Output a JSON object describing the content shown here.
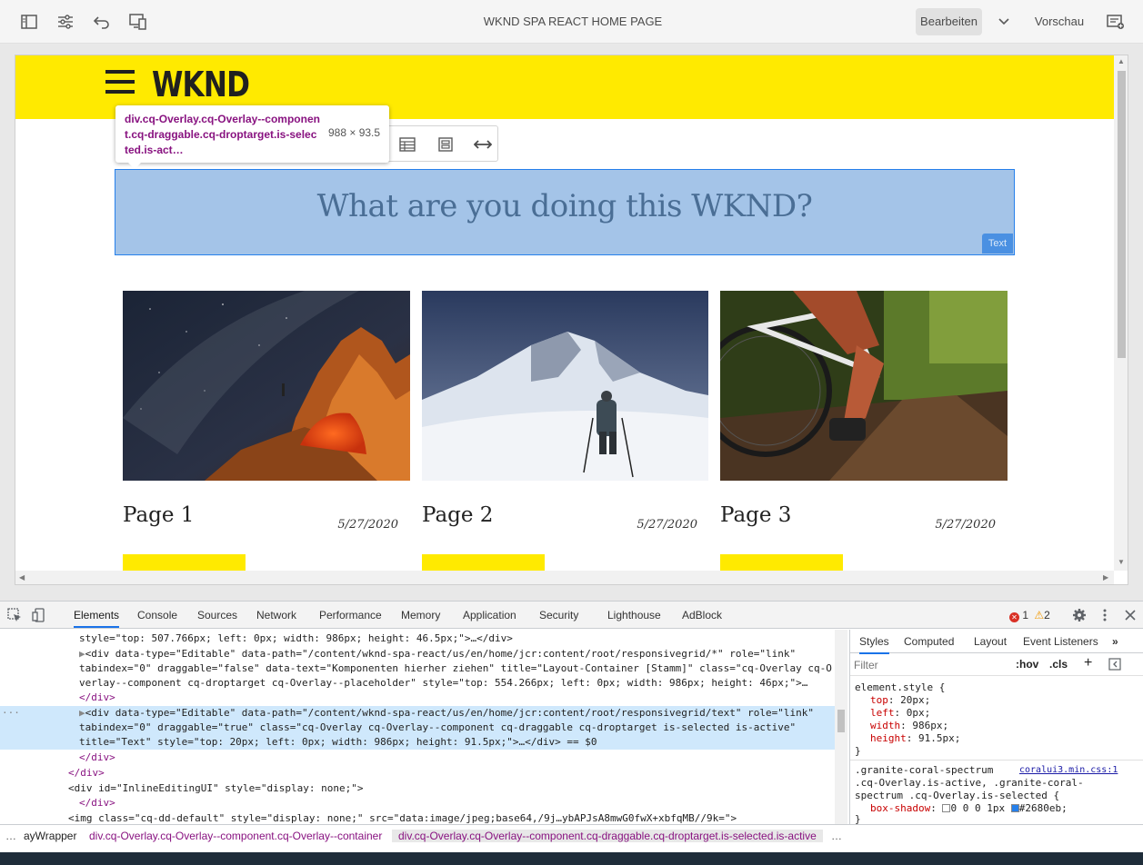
{
  "editor": {
    "page_title": "WKND SPA REACT HOME PAGE",
    "mode_label": "Bearbeiten",
    "preview_label": "Vorschau",
    "icons": [
      "side-panel-icon",
      "page-properties-icon",
      "undo-icon",
      "emulator-icon",
      "annotations-icon"
    ]
  },
  "site": {
    "logo": "WKND",
    "heading": "What are you doing this WKND?",
    "overlay_tag": "Text",
    "cards": [
      {
        "title": "Page 1",
        "date": "5/27/2020",
        "image": "night-camping-photo"
      },
      {
        "title": "Page 2",
        "date": "5/27/2020",
        "image": "snowy-mountain-hiker-photo"
      },
      {
        "title": "Page 3",
        "date": "5/27/2020",
        "image": "mountain-bike-trail-photo"
      }
    ]
  },
  "inspector_tooltip": {
    "selector": "div.cq-Overlay.cq-Overlay--component.cq-draggable.cq-droptarget.is-selected.is-act…",
    "dimensions": "988 × 93.5"
  },
  "devtools": {
    "tabs": [
      "Elements",
      "Console",
      "Sources",
      "Network",
      "Performance",
      "Memory",
      "Application",
      "Security",
      "Lighthouse",
      "AdBlock"
    ],
    "errors": "1",
    "warnings": "2",
    "dom_lines": [
      "style=\"top: 507.766px; left: 0px; width: 986px; height: 46.5px;\">…</div>",
      "<div data-type=\"Editable\" data-path=\"/content/wknd-spa-react/us/en/home/jcr:content/root/responsivegrid/*\" role=\"link\"",
      "tabindex=\"0\" draggable=\"false\" data-text=\"Komponenten hierher ziehen\" title=\"Layout-Container [Stamm]\" class=\"cq-Overlay cq-O",
      "verlay--component cq-droptarget cq-Overlay--placeholder\" style=\"top: 554.266px; left: 0px; width: 986px; height: 46px;\">…",
      "</div>",
      "<div data-type=\"Editable\" data-path=\"/content/wknd-spa-react/us/en/home/jcr:content/root/responsivegrid/text\" role=\"link\"",
      "tabindex=\"0\" draggable=\"true\" class=\"cq-Overlay cq-Overlay--component cq-draggable cq-droptarget is-selected is-active\"",
      "title=\"Text\" style=\"top: 20px; left: 0px; width: 986px; height: 91.5px;\">…</div> == $0",
      "</div>",
      "</div>",
      "<div id=\"InlineEditingUI\" style=\"display: none;\">",
      "</div>",
      "<img class=\"cq-dd-default\" style=\"display: none;\" src=\"data:image/jpeg;base64,/9j…ybAPJsA8mwG0fwX+xbfqMB//9k=\">"
    ],
    "styles_tabs": [
      "Styles",
      "Computed",
      "Layout",
      "Event Listeners"
    ],
    "filter_placeholder": "Filter",
    "hov": ":hov",
    "cls": ".cls",
    "element_style": {
      "header": "element.style {",
      "props": [
        {
          "name": "top",
          "value": "20px;"
        },
        {
          "name": "left",
          "value": "0px;"
        },
        {
          "name": "width",
          "value": "986px;"
        },
        {
          "name": "height",
          "value": "91.5px;"
        }
      ],
      "close": "}"
    },
    "rule2": {
      "selector_lines": [
        ".granite-coral-spectrum",
        ".cq-Overlay.is-active, .granite-coral-",
        "spectrum .cq-Overlay.is-selected {"
      ],
      "source": "coralui3.min.css:1",
      "prop_name": "box-shadow",
      "prop_value": "0 0 0 1px",
      "color": "#2680eb",
      "close": "}"
    },
    "breadcrumbs": [
      "…",
      "ayWrapper",
      "div.cq-Overlay.cq-Overlay--component.cq-Overlay--container",
      "div.cq-Overlay.cq-Overlay--component.cq-draggable.cq-droptarget.is-selected.is-active",
      "…"
    ]
  },
  "colors": {
    "wknd_yellow": "#ffea00",
    "selection_blue": "#2680eb",
    "overlay_fill": "#a4c4e8"
  }
}
